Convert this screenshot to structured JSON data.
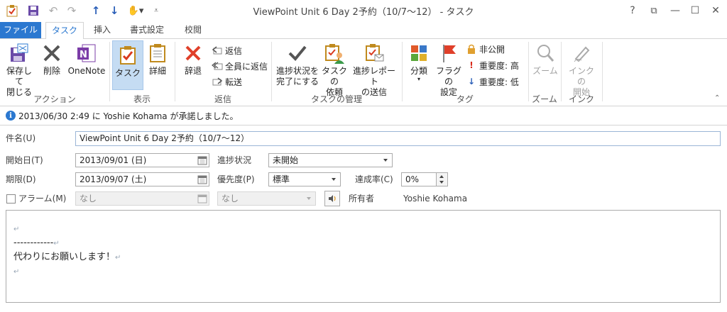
{
  "window": {
    "title": "ViewPoint Unit 6 Day 2予約（10/7～12） - タスク",
    "help": "?",
    "restore_ribbon": "⧉",
    "minimize": "—",
    "maximize": "☐",
    "close": "✕"
  },
  "tabs": [
    {
      "label": "ファイル"
    },
    {
      "label": "タスク"
    },
    {
      "label": "挿入"
    },
    {
      "label": "書式設定"
    },
    {
      "label": "校閲"
    }
  ],
  "ribbon": {
    "actions": {
      "save_close": "保存して\n閉じる",
      "delete": "削除",
      "onenote": "OneNote",
      "group": "アクション"
    },
    "show": {
      "task": "タスク",
      "details": "詳細",
      "group": "表示"
    },
    "respond": {
      "decline": "辞退",
      "reply": "返信",
      "reply_all": "全員に返信",
      "forward": "転送",
      "group": "返信"
    },
    "manage": {
      "mark_complete": "進捗状況を\n完了にする",
      "assign": "タスクの\n依頼",
      "send_report": "進捗レポート\nの送信",
      "group": "タスクの管理"
    },
    "tags": {
      "categorize": "分類",
      "follow_up": "フラグの\n設定",
      "private": "非公開",
      "high": "重要度: 高",
      "low": "重要度: 低",
      "group": "タグ"
    },
    "zoom": {
      "zoom": "ズーム",
      "group": "ズーム"
    },
    "ink": {
      "start": "インクの\n開始",
      "group": "インク"
    }
  },
  "info_bar": "2013/06/30 2:49 に Yoshie Kohama が承諾しました。",
  "form": {
    "subject_label": "件名(U)",
    "subject_value": "ViewPoint Unit 6 Day 2予約（10/7～12）",
    "start_label": "開始日(T)",
    "start_value": "2013/09/01 (日)",
    "due_label": "期限(D)",
    "due_value": "2013/09/07 (土)",
    "status_label": "進捗状況",
    "status_value": "未開始",
    "priority_label": "優先度(P)",
    "priority_value": "標準",
    "percent_label": "達成率(C)",
    "percent_value": "0%",
    "reminder_label": "アラーム(M)",
    "reminder_date": "なし",
    "reminder_time": "なし",
    "owner_label": "所有者",
    "owner_value": "Yoshie Kohama"
  },
  "body_lines": [
    "",
    "------------",
    "代わりにお願いします！",
    ""
  ],
  "colors": {
    "accent": "#2b78d0",
    "file_tab": "#2b78d0",
    "selected_button": "#c5dcf3"
  }
}
